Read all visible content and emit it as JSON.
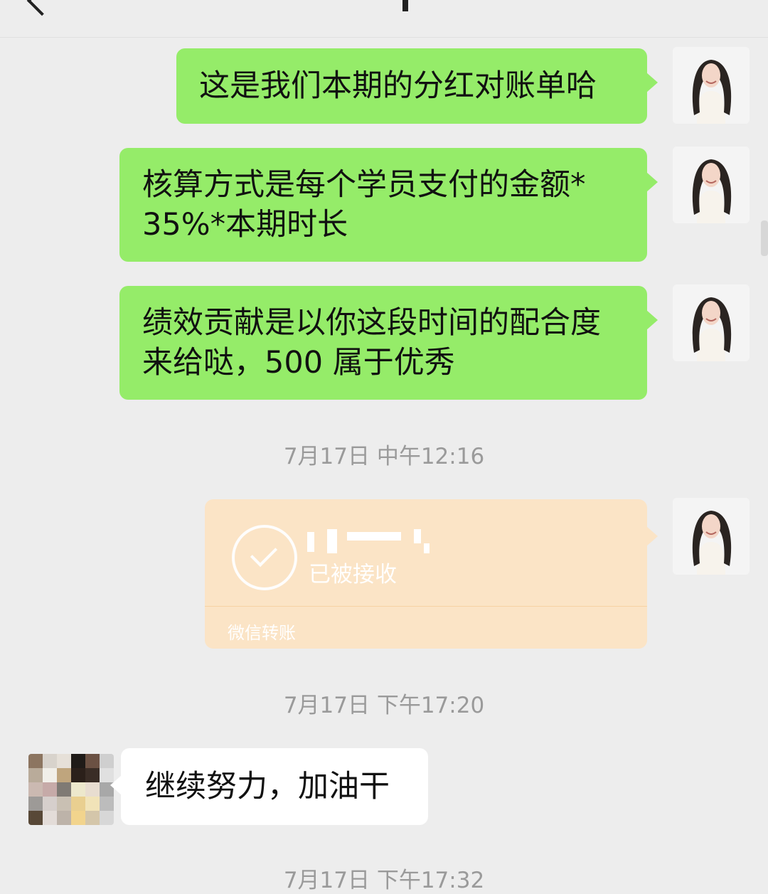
{
  "header": {
    "back_icon": "chevron-left-icon"
  },
  "messages": [
    {
      "side": "right",
      "text": "这是我们本期的分红对账单哈"
    },
    {
      "side": "right",
      "line1": "核算方式是每个学员支付的金额*",
      "line2": "35%*本期时长"
    },
    {
      "side": "right",
      "line1": "绩效贡献是以你这段时间的配合度",
      "line2": "来给哒，500 属于优秀"
    }
  ],
  "timestamps": {
    "t1": "7月17日 中午12:16",
    "t2": "7月17日 下午17:20",
    "t3": "7月17日 下午17:32"
  },
  "transfer": {
    "status": "已被接收",
    "label": "微信转账",
    "icon": "check-circle-icon"
  },
  "reply": {
    "side": "left",
    "text": "继续努力，加油干"
  },
  "colors": {
    "background": "#ededed",
    "sent_bubble": "#95ec69",
    "received_bubble": "#ffffff",
    "transfer_bubble": "#fbe4c6",
    "timestamp": "#9a9a9a"
  }
}
